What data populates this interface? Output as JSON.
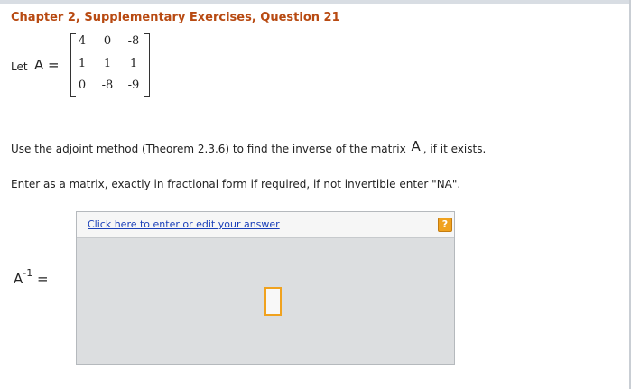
{
  "question": {
    "title": "Chapter 2, Supplementary Exercises, Question 21",
    "let_label": "Let",
    "matrix_name": "A =",
    "matrix": [
      [
        "4",
        "0",
        "-8"
      ],
      [
        "1",
        "1",
        "1"
      ],
      [
        "0",
        "-8",
        "-9"
      ]
    ],
    "instruction_before": "Use the adjoint method (Theorem 2.3.6) to find the inverse of the matrix ",
    "instruction_symbol": "A",
    "instruction_after": ", if it exists.",
    "enter_text": "Enter as a matrix, exactly in fractional form if required, if not invertible enter \"NA\"."
  },
  "answer": {
    "link_text": "Click here to enter or edit your answer",
    "help_icon": "?",
    "label_base": "A",
    "label_exp": "-1",
    "label_eq": " ="
  },
  "colors": {
    "title": "#b84a12",
    "link": "#1a3fb8",
    "accent": "#f0a21f",
    "answer_bg": "#dcdee0"
  },
  "icons": {
    "help": "help-icon"
  }
}
